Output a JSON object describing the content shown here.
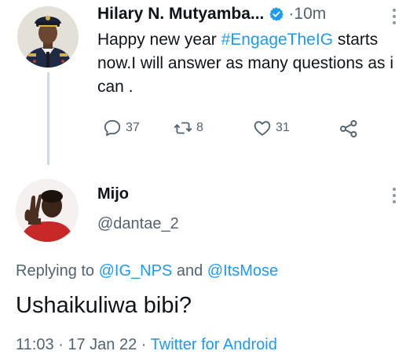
{
  "tweet": {
    "author_name": "Hilary N. Mutyamba...",
    "separator": "·",
    "time_ago": "10m",
    "text_part1": "Happy new year ",
    "hashtag": "#EngageTheIG",
    "text_part2": " starts now.I will answer as many questions as i can .",
    "reply_count": "37",
    "retweet_count": "8",
    "like_count": "31",
    "icons": {
      "verified": "verified-badge-icon",
      "more": "more-vertical-icon",
      "reply": "comment-icon",
      "retweet": "retweet-icon",
      "like": "heart-icon",
      "share": "share-icon"
    }
  },
  "reply": {
    "author_name": "Mijo",
    "handle": "@dantae_2",
    "replying_prefix": "Replying to ",
    "mention1": "@IG_NPS",
    "replying_and": " and ",
    "mention2": "@ItsMose",
    "text": "Ushaikuliwa bibi?",
    "time": "11:03",
    "sep1": " · ",
    "date": "17 Jan 22",
    "sep2": " · ",
    "source": "Twitter for Android"
  },
  "colors": {
    "accent": "#1d9bf0",
    "secondary_text": "#536471",
    "primary_text": "#0f1419"
  }
}
